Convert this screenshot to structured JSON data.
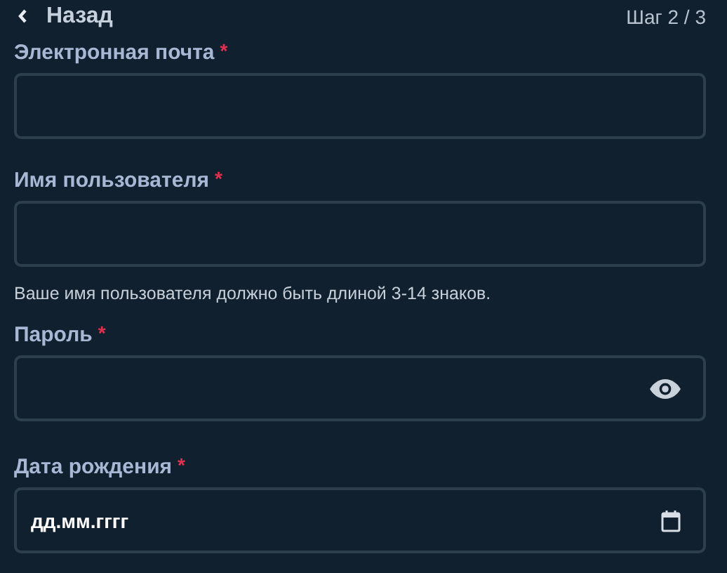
{
  "header": {
    "back": "Назад",
    "step": "Шаг 2 / 3"
  },
  "fields": [
    {
      "kind": "text",
      "label": "Электронная почта",
      "required_mark": "*"
    },
    {
      "kind": "text",
      "label": "Имя пользователя",
      "required_mark": "*",
      "hint": "Ваше имя пользователя должно быть длиной 3-14 знаков."
    },
    {
      "kind": "password",
      "label": "Пароль",
      "required_mark": "*"
    },
    {
      "kind": "date",
      "label": "Дата рождения",
      "required_mark": "*",
      "placeholder": "дд.мм.гггг"
    }
  ]
}
